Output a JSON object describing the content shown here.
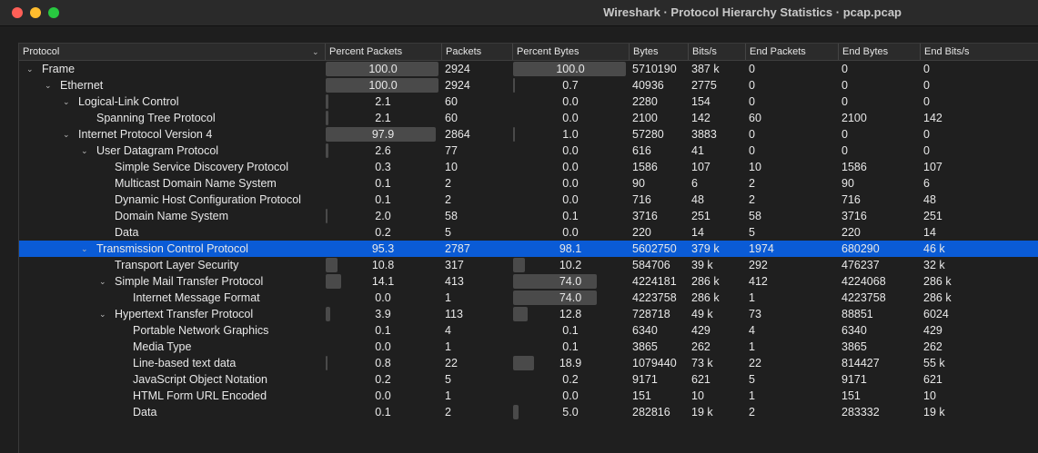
{
  "window": {
    "title": "Wireshark · Protocol Hierarchy Statistics · pcap.pcap"
  },
  "columns": [
    "Protocol",
    "Percent Packets",
    "Packets",
    "Percent Bytes",
    "Bytes",
    "Bits/s",
    "End Packets",
    "End Bytes",
    "End Bits/s"
  ],
  "sort_icon": "chevron-down-icon",
  "colors": {
    "selection": "#0a5bd6",
    "bar": "#4a4a4a",
    "background": "#1e1e1e"
  },
  "rows": [
    {
      "name": "Frame",
      "depth": 0,
      "expanded": true,
      "pct_packets": "100.0",
      "packets": "2924",
      "pct_bytes": "100.0",
      "bytes": "5710190",
      "bits": "387 k",
      "end_packets": "0",
      "end_bytes": "0",
      "end_bits": "0",
      "selected": false
    },
    {
      "name": "Ethernet",
      "depth": 1,
      "expanded": true,
      "pct_packets": "100.0",
      "packets": "2924",
      "pct_bytes": "0.7",
      "bytes": "40936",
      "bits": "2775",
      "end_packets": "0",
      "end_bytes": "0",
      "end_bits": "0",
      "selected": false
    },
    {
      "name": "Logical-Link Control",
      "depth": 2,
      "expanded": true,
      "pct_packets": "2.1",
      "packets": "60",
      "pct_bytes": "0.0",
      "bytes": "2280",
      "bits": "154",
      "end_packets": "0",
      "end_bytes": "0",
      "end_bits": "0",
      "selected": false
    },
    {
      "name": "Spanning Tree Protocol",
      "depth": 3,
      "expanded": false,
      "pct_packets": "2.1",
      "packets": "60",
      "pct_bytes": "0.0",
      "bytes": "2100",
      "bits": "142",
      "end_packets": "60",
      "end_bytes": "2100",
      "end_bits": "142",
      "selected": false
    },
    {
      "name": "Internet Protocol Version 4",
      "depth": 2,
      "expanded": true,
      "pct_packets": "97.9",
      "packets": "2864",
      "pct_bytes": "1.0",
      "bytes": "57280",
      "bits": "3883",
      "end_packets": "0",
      "end_bytes": "0",
      "end_bits": "0",
      "selected": false
    },
    {
      "name": "User Datagram Protocol",
      "depth": 3,
      "expanded": true,
      "pct_packets": "2.6",
      "packets": "77",
      "pct_bytes": "0.0",
      "bytes": "616",
      "bits": "41",
      "end_packets": "0",
      "end_bytes": "0",
      "end_bits": "0",
      "selected": false
    },
    {
      "name": "Simple Service Discovery Protocol",
      "depth": 4,
      "expanded": false,
      "pct_packets": "0.3",
      "packets": "10",
      "pct_bytes": "0.0",
      "bytes": "1586",
      "bits": "107",
      "end_packets": "10",
      "end_bytes": "1586",
      "end_bits": "107",
      "selected": false
    },
    {
      "name": "Multicast Domain Name System",
      "depth": 4,
      "expanded": false,
      "pct_packets": "0.1",
      "packets": "2",
      "pct_bytes": "0.0",
      "bytes": "90",
      "bits": "6",
      "end_packets": "2",
      "end_bytes": "90",
      "end_bits": "6",
      "selected": false
    },
    {
      "name": "Dynamic Host Configuration Protocol",
      "depth": 4,
      "expanded": false,
      "pct_packets": "0.1",
      "packets": "2",
      "pct_bytes": "0.0",
      "bytes": "716",
      "bits": "48",
      "end_packets": "2",
      "end_bytes": "716",
      "end_bits": "48",
      "selected": false
    },
    {
      "name": "Domain Name System",
      "depth": 4,
      "expanded": false,
      "pct_packets": "2.0",
      "packets": "58",
      "pct_bytes": "0.1",
      "bytes": "3716",
      "bits": "251",
      "end_packets": "58",
      "end_bytes": "3716",
      "end_bits": "251",
      "selected": false
    },
    {
      "name": "Data",
      "depth": 4,
      "expanded": false,
      "pct_packets": "0.2",
      "packets": "5",
      "pct_bytes": "0.0",
      "bytes": "220",
      "bits": "14",
      "end_packets": "5",
      "end_bytes": "220",
      "end_bits": "14",
      "selected": false
    },
    {
      "name": "Transmission Control Protocol",
      "depth": 3,
      "expanded": true,
      "pct_packets": "95.3",
      "packets": "2787",
      "pct_bytes": "98.1",
      "bytes": "5602750",
      "bits": "379 k",
      "end_packets": "1974",
      "end_bytes": "680290",
      "end_bits": "46 k",
      "selected": true
    },
    {
      "name": "Transport Layer Security",
      "depth": 4,
      "expanded": false,
      "pct_packets": "10.8",
      "packets": "317",
      "pct_bytes": "10.2",
      "bytes": "584706",
      "bits": "39 k",
      "end_packets": "292",
      "end_bytes": "476237",
      "end_bits": "32 k",
      "selected": false
    },
    {
      "name": "Simple Mail Transfer Protocol",
      "depth": 4,
      "expanded": true,
      "pct_packets": "14.1",
      "packets": "413",
      "pct_bytes": "74.0",
      "bytes": "4224181",
      "bits": "286 k",
      "end_packets": "412",
      "end_bytes": "4224068",
      "end_bits": "286 k",
      "selected": false
    },
    {
      "name": "Internet Message Format",
      "depth": 5,
      "expanded": false,
      "pct_packets": "0.0",
      "packets": "1",
      "pct_bytes": "74.0",
      "bytes": "4223758",
      "bits": "286 k",
      "end_packets": "1",
      "end_bytes": "4223758",
      "end_bits": "286 k",
      "selected": false
    },
    {
      "name": "Hypertext Transfer Protocol",
      "depth": 4,
      "expanded": true,
      "pct_packets": "3.9",
      "packets": "113",
      "pct_bytes": "12.8",
      "bytes": "728718",
      "bits": "49 k",
      "end_packets": "73",
      "end_bytes": "88851",
      "end_bits": "6024",
      "selected": false
    },
    {
      "name": "Portable Network Graphics",
      "depth": 5,
      "expanded": false,
      "pct_packets": "0.1",
      "packets": "4",
      "pct_bytes": "0.1",
      "bytes": "6340",
      "bits": "429",
      "end_packets": "4",
      "end_bytes": "6340",
      "end_bits": "429",
      "selected": false
    },
    {
      "name": "Media Type",
      "depth": 5,
      "expanded": false,
      "pct_packets": "0.0",
      "packets": "1",
      "pct_bytes": "0.1",
      "bytes": "3865",
      "bits": "262",
      "end_packets": "1",
      "end_bytes": "3865",
      "end_bits": "262",
      "selected": false
    },
    {
      "name": "Line-based text data",
      "depth": 5,
      "expanded": false,
      "pct_packets": "0.8",
      "packets": "22",
      "pct_bytes": "18.9",
      "bytes": "1079440",
      "bits": "73 k",
      "end_packets": "22",
      "end_bytes": "814427",
      "end_bits": "55 k",
      "selected": false
    },
    {
      "name": "JavaScript Object Notation",
      "depth": 5,
      "expanded": false,
      "pct_packets": "0.2",
      "packets": "5",
      "pct_bytes": "0.2",
      "bytes": "9171",
      "bits": "621",
      "end_packets": "5",
      "end_bytes": "9171",
      "end_bits": "621",
      "selected": false
    },
    {
      "name": "HTML Form URL Encoded",
      "depth": 5,
      "expanded": false,
      "pct_packets": "0.0",
      "packets": "1",
      "pct_bytes": "0.0",
      "bytes": "151",
      "bits": "10",
      "end_packets": "1",
      "end_bytes": "151",
      "end_bits": "10",
      "selected": false
    },
    {
      "name": "Data",
      "depth": 5,
      "expanded": false,
      "pct_packets": "0.1",
      "packets": "2",
      "pct_bytes": "5.0",
      "bytes": "282816",
      "bits": "19 k",
      "end_packets": "2",
      "end_bytes": "283332",
      "end_bits": "19 k",
      "selected": false
    }
  ]
}
